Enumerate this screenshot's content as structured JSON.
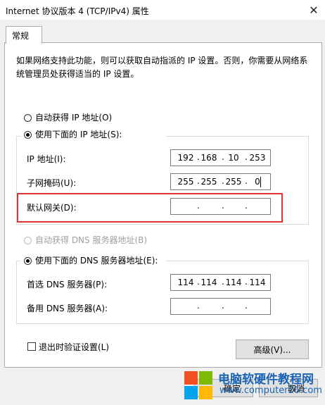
{
  "window": {
    "title": "Internet 协议版本 4 (TCP/IPv4) 属性",
    "close_glyph": "✕"
  },
  "tabs": [
    {
      "label": "常规"
    }
  ],
  "description": "如果网络支持此功能，则可以获取自动指派的 IP 设置。否则，你需要从网络系统管理员处获得适当的 IP 设置。",
  "ip_section": {
    "auto_label": "自动获得 IP 地址(O)",
    "manual_label": "使用下面的 IP 地址(S):",
    "selected": "manual",
    "fields": [
      {
        "label": "IP 地址(I):",
        "octets": [
          "192",
          "168",
          "10",
          "253"
        ]
      },
      {
        "label": "子网掩码(U):",
        "octets": [
          "255",
          "255",
          "255",
          "0"
        ]
      },
      {
        "label": "默认网关(D):",
        "octets": [
          "",
          "",
          "",
          ""
        ]
      }
    ]
  },
  "dns_section": {
    "auto_label": "自动获得 DNS 服务器地址(B)",
    "manual_label": "使用下面的 DNS 服务器地址(E):",
    "selected": "manual",
    "fields": [
      {
        "label": "首选 DNS 服务器(P):",
        "octets": [
          "114",
          "114",
          "114",
          "114"
        ]
      },
      {
        "label": "备用 DNS 服务器(A):",
        "octets": [
          "",
          "",
          "",
          ""
        ]
      }
    ]
  },
  "validate_checkbox": {
    "label": "退出时验证设置(L)",
    "checked": false
  },
  "buttons": {
    "advanced": "高级(V)...",
    "ok": "确定",
    "cancel": "取消"
  },
  "watermark": {
    "text": "电脑软硬件教程网",
    "url": "www.computer26.com"
  },
  "colors": {
    "highlight": "#e53333",
    "watermark": "#1a64b4"
  }
}
